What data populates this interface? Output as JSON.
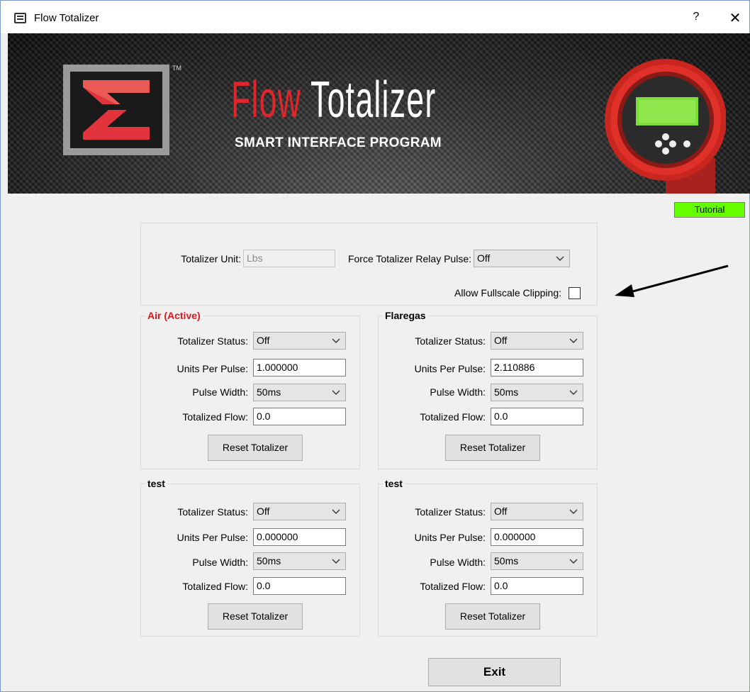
{
  "window": {
    "title": "Flow Totalizer",
    "help": "?",
    "close": "✕"
  },
  "banner": {
    "title_part1": "Flow",
    "title_part2": "Totalizer",
    "subtitle": "SMART INTERFACE PROGRAM",
    "trademark": "TM"
  },
  "tutorial_label": "Tutorial",
  "settings": {
    "unit_label": "Totalizer Unit:",
    "unit_value": "Lbs",
    "force_pulse_label": "Force Totalizer Relay Pulse:",
    "force_pulse_value": "Off",
    "clipping_label": "Allow Fullscale Clipping:",
    "clipping_checked": false
  },
  "field_labels": {
    "status": "Totalizer Status:",
    "units_per_pulse": "Units Per Pulse:",
    "pulse_width": "Pulse Width:",
    "totalized_flow": "Totalized Flow:",
    "reset": "Reset Totalizer"
  },
  "groups": [
    {
      "title": "Air (Active)",
      "status": "Off",
      "units_per_pulse": "1.000000",
      "pulse_width": "50ms",
      "totalized_flow": "0.0"
    },
    {
      "title": "Flaregas",
      "status": "Off",
      "units_per_pulse": "2.110886",
      "pulse_width": "50ms",
      "totalized_flow": "0.0"
    },
    {
      "title": "test",
      "status": "Off",
      "units_per_pulse": "0.000000",
      "pulse_width": "50ms",
      "totalized_flow": "0.0"
    },
    {
      "title": "test",
      "status": "Off",
      "units_per_pulse": "0.000000",
      "pulse_width": "50ms",
      "totalized_flow": "0.0"
    }
  ],
  "exit_label": "Exit",
  "colors": {
    "active_group_title": "#e0161c",
    "tutorial_bg": "#66ff00",
    "brand_red": "#e0262b"
  }
}
